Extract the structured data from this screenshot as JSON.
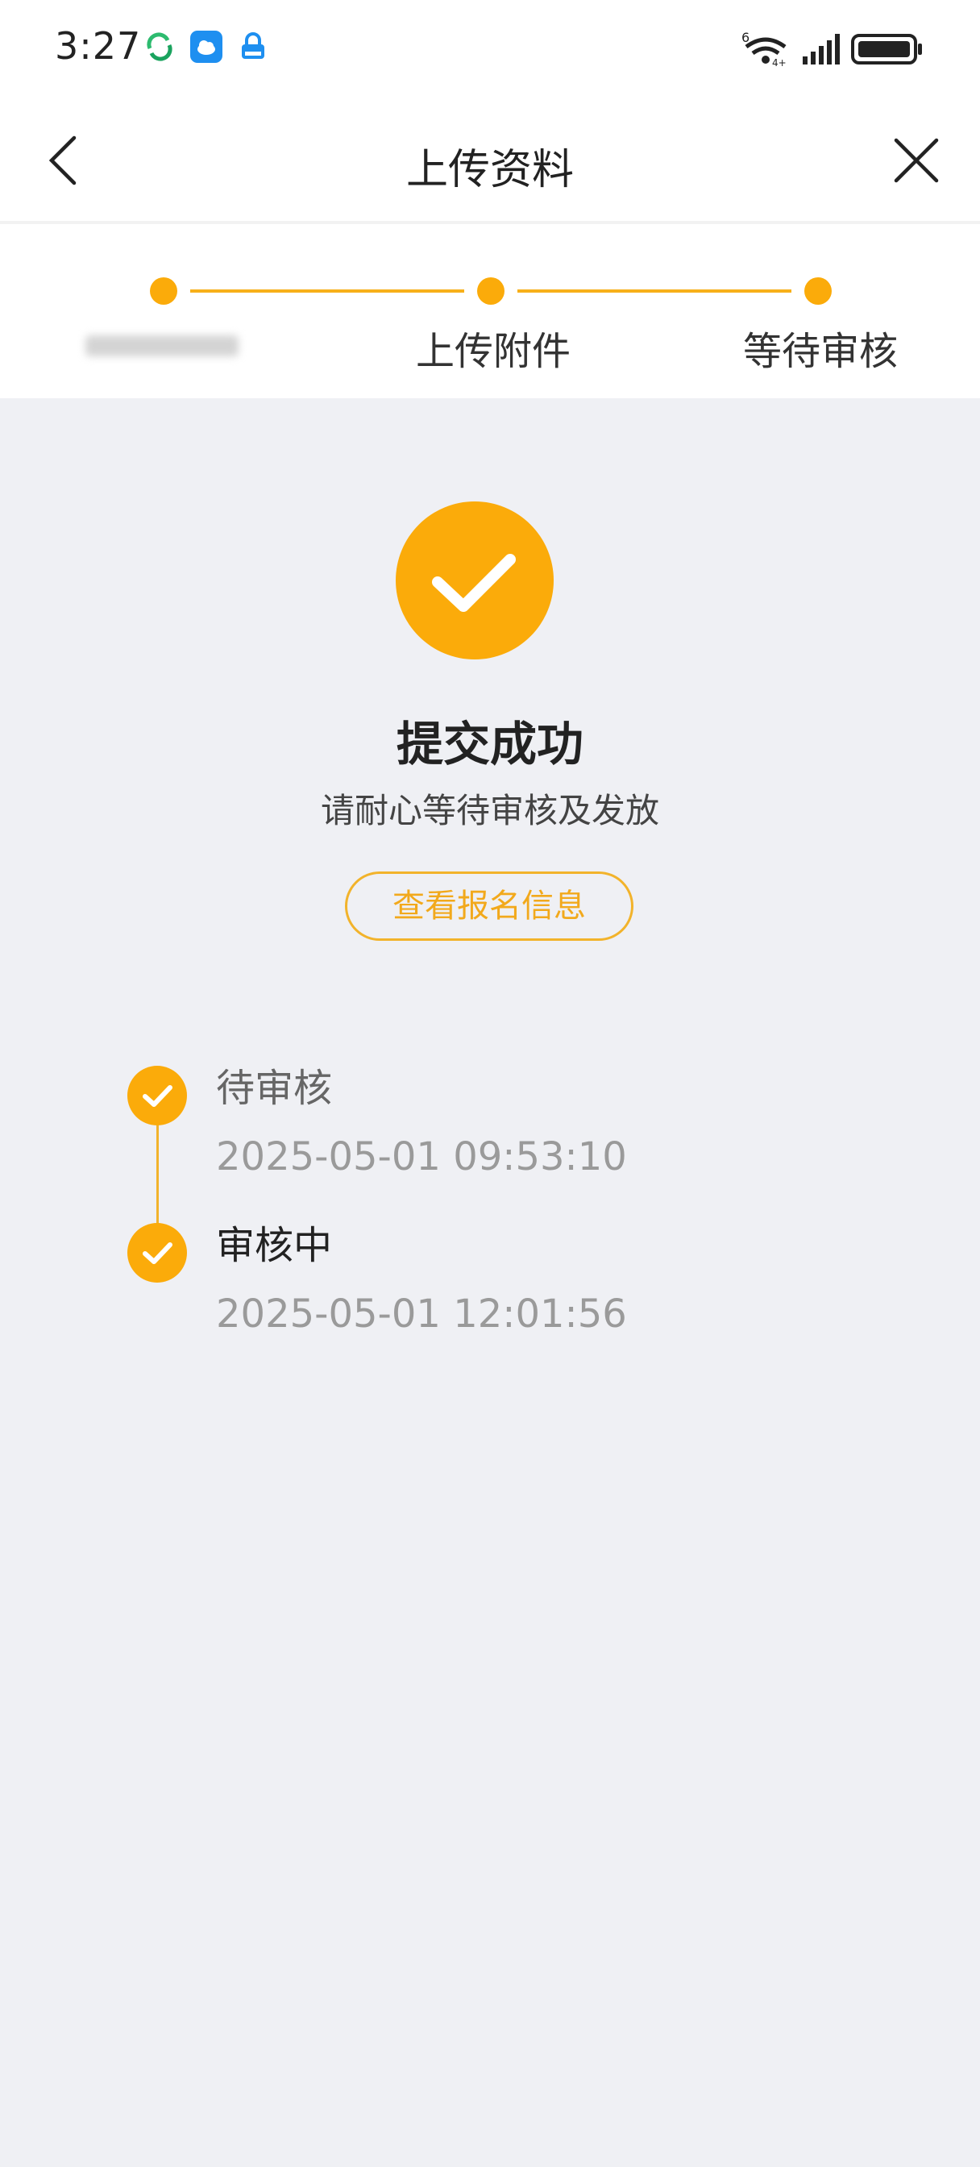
{
  "status_bar": {
    "time": "3:27",
    "network": "6",
    "network_sub": "4+"
  },
  "nav": {
    "title": "上传资料"
  },
  "steps": [
    {
      "label": "",
      "state": "done"
    },
    {
      "label": "上传附件",
      "state": "done"
    },
    {
      "label": "等待审核",
      "state": "current"
    }
  ],
  "success": {
    "title": "提交成功",
    "subtitle": "请耐心等待审核及发放",
    "view_button": "查看报名信息"
  },
  "timeline": [
    {
      "title": "待审核",
      "time": "2025-05-01 09:53:10"
    },
    {
      "title": "审核中",
      "time": "2025-05-01 12:01:56"
    }
  ],
  "colors": {
    "accent": "#fbab0a",
    "button_border": "#f2b32b",
    "background": "#eff0f4"
  }
}
